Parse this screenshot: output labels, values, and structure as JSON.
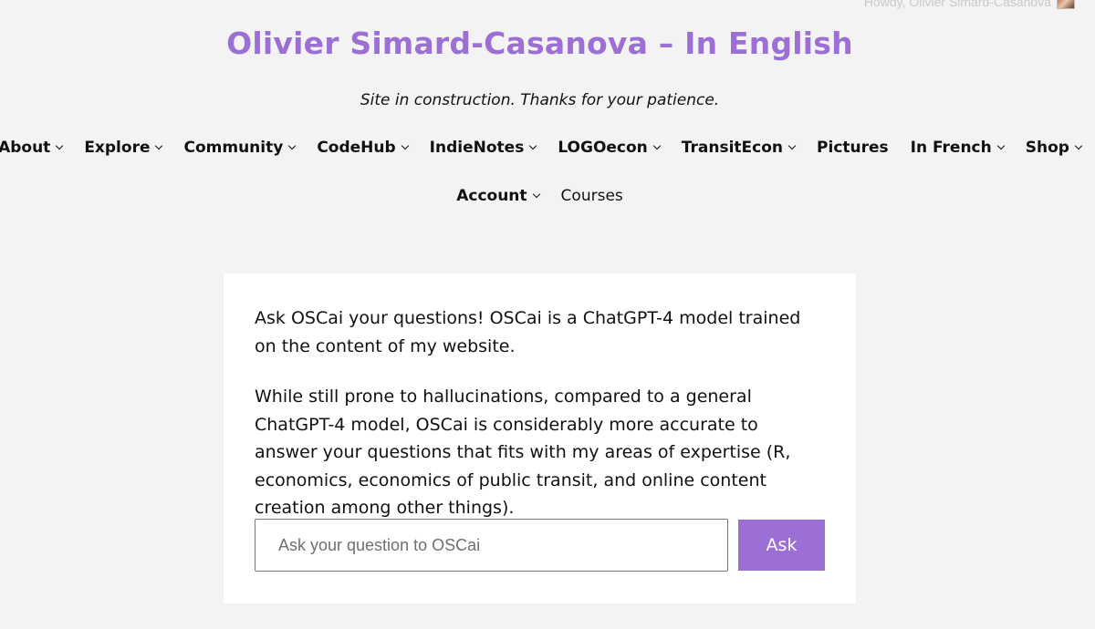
{
  "admin_bar": {
    "greeting": "Howdy, Olivier Simard-Casanova"
  },
  "header": {
    "site_title": "Olivier Simard-Casanova – In English",
    "tagline": "Site in construction. Thanks for your patience."
  },
  "nav": {
    "row1": [
      {
        "label": "About",
        "has_dropdown": true
      },
      {
        "label": "Explore",
        "has_dropdown": true
      },
      {
        "label": "Community",
        "has_dropdown": true
      },
      {
        "label": "CodeHub",
        "has_dropdown": true
      },
      {
        "label": "IndieNotes",
        "has_dropdown": true
      },
      {
        "label": "LOGOecon",
        "has_dropdown": true
      },
      {
        "label": "TransitEcon",
        "has_dropdown": true
      },
      {
        "label": "Pictures",
        "has_dropdown": false
      },
      {
        "label": "In French",
        "has_dropdown": true
      },
      {
        "label": "Shop",
        "has_dropdown": true
      }
    ],
    "row2": [
      {
        "label": "Account",
        "has_dropdown": true
      },
      {
        "label": "Courses",
        "has_dropdown": false
      }
    ]
  },
  "content": {
    "paragraph_1": "Ask OSCai your questions! OSCai is a ChatGPT-4 model trained on the content of my website.",
    "paragraph_2": "While still prone to hallucinations, compared to a general ChatGPT-4 model, OSCai is considerably more accurate to answer your questions that fits with my areas of expertise (R, economics, economics of public transit, and online content creation among other things).",
    "question_input": {
      "value": "",
      "placeholder": "Ask your question to OSCai"
    },
    "ask_button_label": "Ask"
  },
  "colors": {
    "accent": "#9b6fd3",
    "background": "#f3f3f3",
    "card": "#ffffff"
  }
}
